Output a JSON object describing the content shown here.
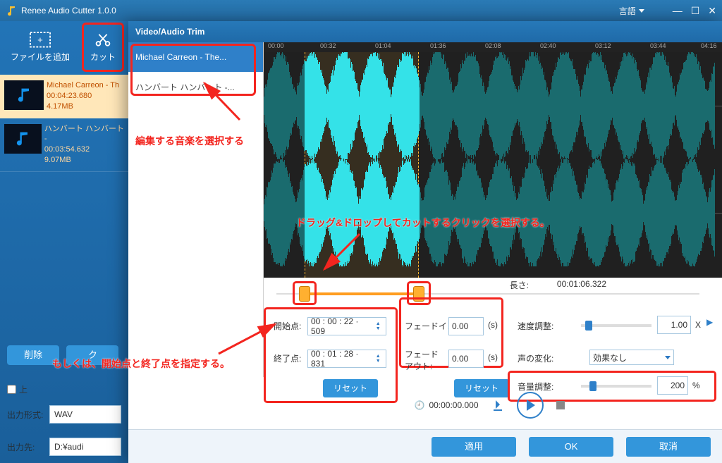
{
  "app": {
    "title": "Renee Audio Cutter 1.0.0"
  },
  "titlebar": {
    "language": "言語"
  },
  "toolbar": {
    "add_file": "ファイルを追加",
    "cut": "カット"
  },
  "files": [
    {
      "name": "Michael Carreon - Th",
      "duration": "00:04:23.680",
      "size": "4.17MB",
      "selected": true
    },
    {
      "name": "ハンバート ハンバート -",
      "duration": "00:03:54.632",
      "size": "9.07MB",
      "selected": false
    }
  ],
  "left_buttons": {
    "delete": "削除",
    "clear": "ク"
  },
  "output": {
    "format_label": "出力形式:",
    "format_value": "WAV",
    "dest_label": "出力先:",
    "dest_value": "D:¥audi"
  },
  "trim": {
    "title": "Video/Audio Trim",
    "tracks": [
      "Michael Carreon - The...",
      "ハンバート ハンバート -..."
    ],
    "ruler": [
      "00:00",
      "00:32",
      "01:04",
      "01:36",
      "02:08",
      "02:40",
      "03:12",
      "03:44",
      "04:16"
    ],
    "length_label": "長さ:",
    "length_value": "00:01:06.322",
    "start_label": "開始点:",
    "start_value": "00 : 00 : 22 · 509",
    "end_label": "終了点:",
    "end_value": "00 : 01 : 28 · 831",
    "reset": "リセット",
    "fadein_label": "フェードイン:",
    "fadein_value": "0.00",
    "fadeout_label": "フェードアウト:",
    "fadeout_value": "0.00",
    "seconds": "(s)",
    "speed_label": "速度調整:",
    "speed_value": "1.00",
    "speed_unit": "X",
    "voice_label": "声の変化:",
    "voice_value": "効果なし",
    "volume_label": "音量調整:",
    "volume_value": "200",
    "volume_unit": "%",
    "playpos": "00:00:00.000",
    "apply": "適用",
    "ok": "OK",
    "cancel": "取消"
  },
  "anno": {
    "select_song": "編集する音楽を選択する",
    "drag_clip": "ドラッグ&ドロップしてカットするクリックを選択する。",
    "or_points": "もしくは、開始点と終了点を指定する。"
  }
}
